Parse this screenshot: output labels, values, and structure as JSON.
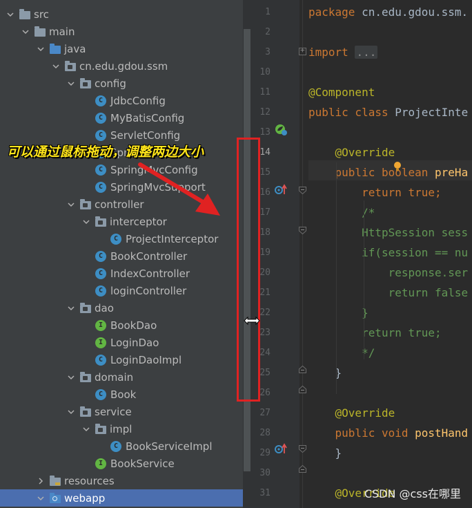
{
  "tree": {
    "rows": [
      {
        "label": "src",
        "depth": 0,
        "kind": "folder",
        "expanded": true,
        "icon": "folder-icon"
      },
      {
        "label": "main",
        "depth": 1,
        "kind": "folder",
        "expanded": true,
        "icon": "folder-icon"
      },
      {
        "label": "java",
        "depth": 2,
        "kind": "src",
        "expanded": true,
        "icon": "source-root-folder-icon"
      },
      {
        "label": "cn.edu.gdou.ssm",
        "depth": 3,
        "kind": "pkg",
        "expanded": true,
        "icon": "package-icon"
      },
      {
        "label": "config",
        "depth": 4,
        "kind": "pkg",
        "expanded": true,
        "icon": "package-icon"
      },
      {
        "label": "JdbcConfig",
        "depth": 5,
        "kind": "class",
        "icon": "class-icon"
      },
      {
        "label": "MyBatisConfig",
        "depth": 5,
        "kind": "class",
        "icon": "class-icon"
      },
      {
        "label": "ServletConfig",
        "depth": 5,
        "kind": "class",
        "icon": "class-icon"
      },
      {
        "label": "Spri",
        "depth": 5,
        "kind": "class",
        "icon": "class-icon"
      },
      {
        "label": "SpringMvcConfig",
        "depth": 5,
        "kind": "class",
        "icon": "class-icon"
      },
      {
        "label": "SpringMvcSupport",
        "depth": 5,
        "kind": "class",
        "icon": "class-icon"
      },
      {
        "label": "controller",
        "depth": 4,
        "kind": "pkg",
        "expanded": true,
        "icon": "package-icon"
      },
      {
        "label": "interceptor",
        "depth": 5,
        "kind": "pkg",
        "expanded": true,
        "icon": "package-icon"
      },
      {
        "label": "ProjectInterceptor",
        "depth": 6,
        "kind": "class",
        "icon": "class-icon"
      },
      {
        "label": "BookController",
        "depth": 5,
        "kind": "class",
        "icon": "class-icon"
      },
      {
        "label": "IndexController",
        "depth": 5,
        "kind": "class",
        "icon": "class-icon"
      },
      {
        "label": "loginController",
        "depth": 5,
        "kind": "class",
        "icon": "class-icon"
      },
      {
        "label": "dao",
        "depth": 4,
        "kind": "pkg",
        "expanded": true,
        "icon": "package-icon"
      },
      {
        "label": "BookDao",
        "depth": 5,
        "kind": "iface",
        "icon": "interface-icon"
      },
      {
        "label": "LoginDao",
        "depth": 5,
        "kind": "iface",
        "icon": "interface-icon"
      },
      {
        "label": "LoginDaoImpl",
        "depth": 5,
        "kind": "class",
        "icon": "class-icon"
      },
      {
        "label": "domain",
        "depth": 4,
        "kind": "pkg",
        "expanded": true,
        "icon": "package-icon"
      },
      {
        "label": "Book",
        "depth": 5,
        "kind": "class",
        "icon": "class-icon"
      },
      {
        "label": "service",
        "depth": 4,
        "kind": "pkg",
        "expanded": true,
        "icon": "package-icon"
      },
      {
        "label": "impl",
        "depth": 5,
        "kind": "pkg",
        "expanded": true,
        "icon": "package-icon"
      },
      {
        "label": "BookServiceImpl",
        "depth": 6,
        "kind": "class",
        "icon": "class-icon"
      },
      {
        "label": "BookService",
        "depth": 5,
        "kind": "iface",
        "icon": "interface-icon"
      },
      {
        "label": "resources",
        "depth": 2,
        "kind": "res",
        "expanded": false,
        "icon": "resources-folder-icon"
      },
      {
        "label": "webapp",
        "depth": 2,
        "kind": "web",
        "expanded": true,
        "selected": true,
        "icon": "web-folder-icon"
      }
    ],
    "class_letter": "C",
    "interface_letter": "I"
  },
  "editor": {
    "lines": [
      {
        "n": "1",
        "tokens": [
          [
            "kw",
            "package "
          ],
          [
            "",
            "cn.edu.gdou.ssm."
          ]
        ]
      },
      {
        "n": "2",
        "tokens": []
      },
      {
        "n": "3",
        "tokens": [
          [
            "kw",
            "import "
          ],
          [
            "dots",
            "..."
          ]
        ]
      },
      {
        "n": "10",
        "tokens": []
      },
      {
        "n": "11",
        "tokens": [
          [
            "ann",
            "@Component"
          ]
        ]
      },
      {
        "n": "12",
        "tokens": [
          [
            "kw",
            "public class "
          ],
          [
            "",
            "ProjectInte"
          ]
        ]
      },
      {
        "n": "13",
        "tokens": []
      },
      {
        "n": "14",
        "tokens": [
          [
            "ann",
            "    @Override"
          ]
        ]
      },
      {
        "n": "15",
        "tokens": [
          [
            "kw",
            "    public boolean "
          ],
          [
            "fn",
            "preHa"
          ]
        ]
      },
      {
        "n": "16",
        "tokens": [
          [
            "kw",
            "        return true"
          ],
          [
            "kw",
            ";"
          ]
        ]
      },
      {
        "n": "17",
        "tokens": [
          [
            "cm",
            "        /*"
          ]
        ]
      },
      {
        "n": "18",
        "tokens": [
          [
            "cm",
            "        HttpSession sess"
          ]
        ]
      },
      {
        "n": "19",
        "tokens": [
          [
            "cm",
            "        if(session == nu"
          ]
        ]
      },
      {
        "n": "20",
        "tokens": [
          [
            "cm",
            "            response.ser"
          ]
        ]
      },
      {
        "n": "21",
        "tokens": [
          [
            "cm",
            "            return false"
          ]
        ]
      },
      {
        "n": "22",
        "tokens": [
          [
            "cm",
            "        }"
          ]
        ]
      },
      {
        "n": "23",
        "tokens": [
          [
            "cm",
            "        return true;"
          ]
        ]
      },
      {
        "n": "24",
        "tokens": [
          [
            "cm",
            "        */"
          ]
        ]
      },
      {
        "n": "25",
        "tokens": [
          [
            "",
            "    }"
          ]
        ]
      },
      {
        "n": "26",
        "tokens": []
      },
      {
        "n": "27",
        "tokens": [
          [
            "ann",
            "    @Override"
          ]
        ]
      },
      {
        "n": "28",
        "tokens": [
          [
            "kw",
            "    public void "
          ],
          [
            "fn",
            "postHand"
          ]
        ]
      },
      {
        "n": "29",
        "tokens": [
          [
            "",
            "    }"
          ]
        ]
      },
      {
        "n": "30",
        "tokens": []
      },
      {
        "n": "31",
        "tokens": [
          [
            "ann",
            "    @Override"
          ]
        ]
      }
    ],
    "current_line": "14"
  },
  "annotation": {
    "text": "可以通过鼠标拖动，调整两边大小",
    "color": "#ffe51a",
    "box_color": "#e02222",
    "arrow_color": "#e02222"
  },
  "watermark": "CSDN @css在哪里",
  "colors": {
    "tree_bg": "#3c3f41",
    "editor_bg": "#2b2b2b",
    "selection": "#4b6eaf",
    "keyword": "#cc7832",
    "annotation": "#bbb529",
    "method": "#ffc66d",
    "comment": "#629755"
  }
}
